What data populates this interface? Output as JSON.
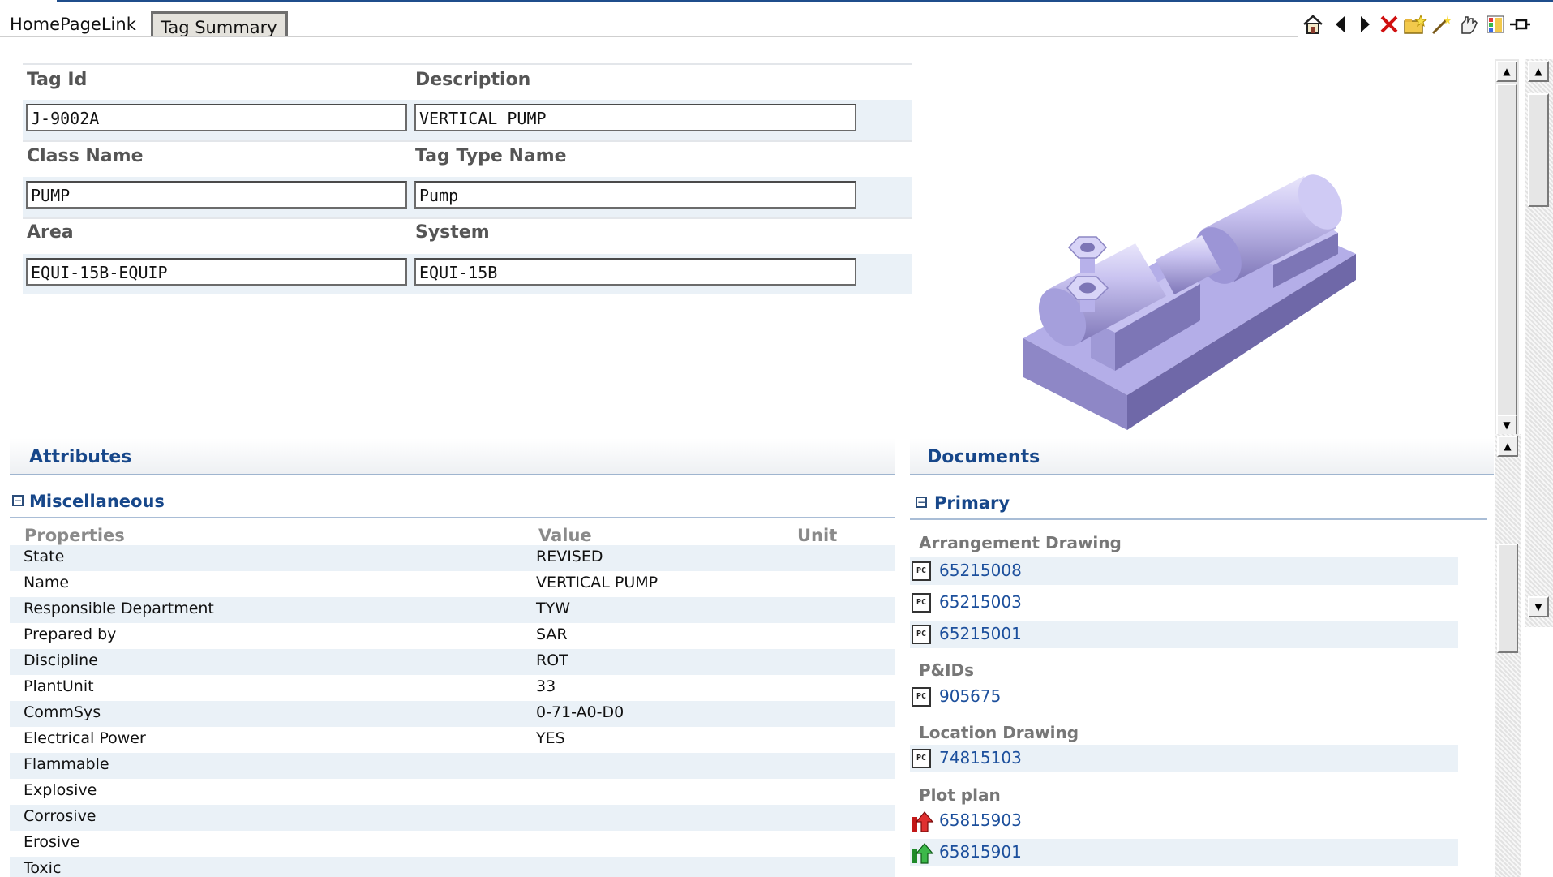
{
  "tabs": [
    {
      "label": "HomePageLink",
      "active": false
    },
    {
      "label": "Tag Summary",
      "active": true
    }
  ],
  "toolbar": {
    "icons": [
      "home-icon",
      "back-icon",
      "forward-icon",
      "close-icon",
      "folder-star-icon",
      "magic-wand-icon",
      "hand-icon",
      "color-palette-icon",
      "pin-icon"
    ]
  },
  "form": {
    "tag_id": {
      "label": "Tag Id",
      "value": "J-9002A"
    },
    "description": {
      "label": "Description",
      "value": "VERTICAL PUMP"
    },
    "class_name": {
      "label": "Class Name",
      "value": "PUMP"
    },
    "tag_type_name": {
      "label": "Tag Type Name",
      "value": "Pump"
    },
    "area": {
      "label": "Area",
      "value": "EQUI-15B-EQUIP"
    },
    "system": {
      "label": "System",
      "value": "EQUI-15B"
    }
  },
  "image": {
    "subject": "3D pump model",
    "color": "#b4aee8"
  },
  "attributes": {
    "title": "Attributes",
    "group": "Miscellaneous",
    "headers": {
      "property": "Properties",
      "value": "Value",
      "unit": "Unit"
    },
    "rows": [
      {
        "property": "State",
        "value": "REVISED"
      },
      {
        "property": "Name",
        "value": "VERTICAL PUMP"
      },
      {
        "property": "Responsible Department",
        "value": "TYW"
      },
      {
        "property": "Prepared by",
        "value": "SAR"
      },
      {
        "property": "Discipline",
        "value": "ROT"
      },
      {
        "property": "PlantUnit",
        "value": "33"
      },
      {
        "property": "CommSys",
        "value": "0-71-A0-D0"
      },
      {
        "property": "Electrical Power",
        "value": "YES"
      },
      {
        "property": "Flammable",
        "value": ""
      },
      {
        "property": "Explosive",
        "value": ""
      },
      {
        "property": "Corrosive",
        "value": ""
      },
      {
        "property": "Erosive",
        "value": ""
      },
      {
        "property": "Toxic",
        "value": ""
      }
    ]
  },
  "documents": {
    "title": "Documents",
    "group": "Primary",
    "categories": [
      {
        "name": "Arrangement Drawing",
        "items": [
          {
            "number": "65215008",
            "icon": "drawing-icon"
          },
          {
            "number": "65215003",
            "icon": "drawing-icon"
          },
          {
            "number": "65215001",
            "icon": "drawing-icon"
          }
        ]
      },
      {
        "name": "P&IDs",
        "items": [
          {
            "number": "905675",
            "icon": "drawing-icon"
          }
        ]
      },
      {
        "name": "Location Drawing",
        "items": [
          {
            "number": "74815103",
            "icon": "drawing-icon"
          }
        ]
      },
      {
        "name": "Plot plan",
        "items": [
          {
            "number": "65815903",
            "icon": "red-plot-icon"
          },
          {
            "number": "65815901",
            "icon": "green-plot-icon"
          }
        ]
      }
    ]
  },
  "colors": {
    "accent": "#17478a",
    "link": "#1c4f9c",
    "row_band": "#eaf1f7"
  }
}
